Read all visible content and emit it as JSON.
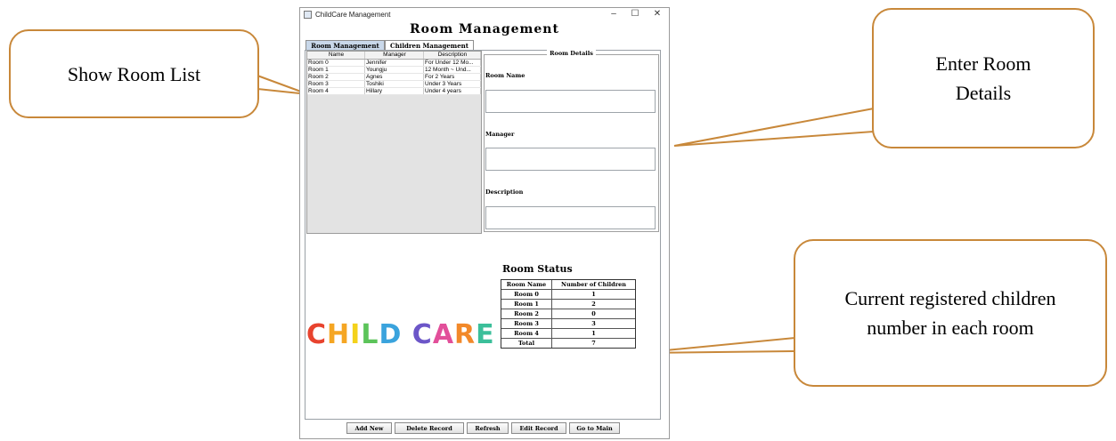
{
  "annotations": {
    "show_room_list": "Show Room List",
    "enter_room_details": "Enter Room Details",
    "current_children": "Current registered children number in each room"
  },
  "window": {
    "title": "ChildCare Management",
    "controls": {
      "minimize": "–",
      "maximize": "☐",
      "close": "✕"
    }
  },
  "heading": "Room Management",
  "tabs": [
    {
      "label": "Room Management",
      "active": true
    },
    {
      "label": "Children Management",
      "active": false
    }
  ],
  "room_table": {
    "columns": [
      "Name",
      "Manager",
      "Description"
    ],
    "rows": [
      [
        "Room 0",
        "Jennifer",
        "For Under 12 Mo..."
      ],
      [
        "Room 1",
        "Youngju",
        "12 Month ~ Und..."
      ],
      [
        "Room 2",
        "Agnes",
        "For 2 Years"
      ],
      [
        "Room 3",
        "Toshiki",
        "Under 3 Years"
      ],
      [
        "Room 4",
        "Hillary",
        "Under 4 years"
      ]
    ]
  },
  "details": {
    "legend": "Room Details",
    "room_name_label": "Room Name",
    "manager_label": "Manager",
    "description_label": "Description",
    "room_name_value": "",
    "manager_value": "",
    "description_value": ""
  },
  "status": {
    "title": "Room Status",
    "columns": [
      "Room Name",
      "Number of Children"
    ],
    "rows": [
      [
        "Room 0",
        "1"
      ],
      [
        "Room 1",
        "2"
      ],
      [
        "Room 2",
        "0"
      ],
      [
        "Room 3",
        "3"
      ],
      [
        "Room 4",
        "1"
      ],
      [
        "Total",
        "7"
      ]
    ]
  },
  "logo": {
    "letters": [
      "C",
      "H",
      "I",
      "L",
      "D",
      " ",
      "C",
      "A",
      "R",
      "E"
    ],
    "colors": [
      "#e8432e",
      "#f5a623",
      "#f4d21b",
      "#5cc45a",
      "#3aa3dd",
      "",
      "#6c56c8",
      "#e24f9a",
      "#f2892a",
      "#3bbf9a"
    ]
  },
  "buttons": {
    "add_new": "Add New",
    "delete_record": "Delete Record",
    "refresh": "Refresh",
    "edit_record": "Edit Record",
    "go_to_main": "Go to Main"
  },
  "colors": {
    "callout_border": "#c8883a",
    "tab_active": "#c9d8ea"
  }
}
